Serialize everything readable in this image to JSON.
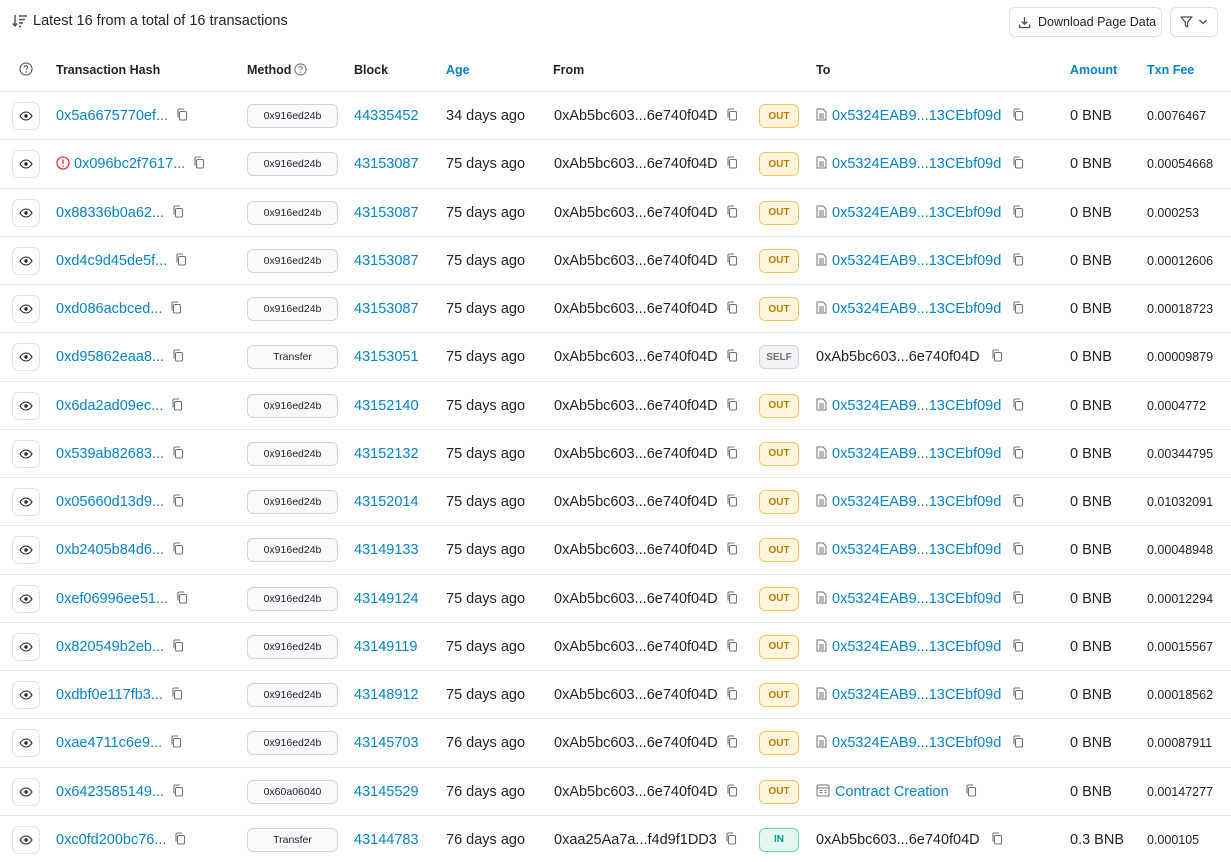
{
  "header": {
    "summary": "Latest 16 from a total of 16 transactions",
    "download_label": "Download Page Data"
  },
  "columns": {
    "hash": "Transaction Hash",
    "method": "Method",
    "block": "Block",
    "age": "Age",
    "from": "From",
    "to": "To",
    "amount": "Amount",
    "fee": "Txn Fee"
  },
  "rows": [
    {
      "hash": "0x5a6675770ef...",
      "error": false,
      "method": "0x916ed24b",
      "block": "44335452",
      "age": "34 days ago",
      "from": "0xAb5bc603...6e740f04D",
      "from_link": false,
      "dir": "OUT",
      "to": "0x5324EAB9...13CEbf09d",
      "to_type": "contract",
      "amount": "0 BNB",
      "fee": "0.0076467"
    },
    {
      "hash": "0x096bc2f7617...",
      "error": true,
      "method": "0x916ed24b",
      "block": "43153087",
      "age": "75 days ago",
      "from": "0xAb5bc603...6e740f04D",
      "from_link": false,
      "dir": "OUT",
      "to": "0x5324EAB9...13CEbf09d",
      "to_type": "contract",
      "amount": "0 BNB",
      "fee": "0.00054668"
    },
    {
      "hash": "0x88336b0a62...",
      "error": false,
      "method": "0x916ed24b",
      "block": "43153087",
      "age": "75 days ago",
      "from": "0xAb5bc603...6e740f04D",
      "from_link": false,
      "dir": "OUT",
      "to": "0x5324EAB9...13CEbf09d",
      "to_type": "contract",
      "amount": "0 BNB",
      "fee": "0.000253"
    },
    {
      "hash": "0xd4c9d45de5f...",
      "error": false,
      "method": "0x916ed24b",
      "block": "43153087",
      "age": "75 days ago",
      "from": "0xAb5bc603...6e740f04D",
      "from_link": false,
      "dir": "OUT",
      "to": "0x5324EAB9...13CEbf09d",
      "to_type": "contract",
      "amount": "0 BNB",
      "fee": "0.00012606"
    },
    {
      "hash": "0xd086acbced...",
      "error": false,
      "method": "0x916ed24b",
      "block": "43153087",
      "age": "75 days ago",
      "from": "0xAb5bc603...6e740f04D",
      "from_link": false,
      "dir": "OUT",
      "to": "0x5324EAB9...13CEbf09d",
      "to_type": "contract",
      "amount": "0 BNB",
      "fee": "0.00018723"
    },
    {
      "hash": "0xd95862eaa8...",
      "error": false,
      "method": "Transfer",
      "block": "43153051",
      "age": "75 days ago",
      "from": "0xAb5bc603...6e740f04D",
      "from_link": false,
      "dir": "SELF",
      "to": "0xAb5bc603...6e740f04D",
      "to_type": "plain",
      "amount": "0 BNB",
      "fee": "0.00009879"
    },
    {
      "hash": "0x6da2ad09ec...",
      "error": false,
      "method": "0x916ed24b",
      "block": "43152140",
      "age": "75 days ago",
      "from": "0xAb5bc603...6e740f04D",
      "from_link": false,
      "dir": "OUT",
      "to": "0x5324EAB9...13CEbf09d",
      "to_type": "contract",
      "amount": "0 BNB",
      "fee": "0.0004772"
    },
    {
      "hash": "0x539ab82683...",
      "error": false,
      "method": "0x916ed24b",
      "block": "43152132",
      "age": "75 days ago",
      "from": "0xAb5bc603...6e740f04D",
      "from_link": false,
      "dir": "OUT",
      "to": "0x5324EAB9...13CEbf09d",
      "to_type": "contract",
      "amount": "0 BNB",
      "fee": "0.00344795"
    },
    {
      "hash": "0x05660d13d9...",
      "error": false,
      "method": "0x916ed24b",
      "block": "43152014",
      "age": "75 days ago",
      "from": "0xAb5bc603...6e740f04D",
      "from_link": false,
      "dir": "OUT",
      "to": "0x5324EAB9...13CEbf09d",
      "to_type": "contract",
      "amount": "0 BNB",
      "fee": "0.01032091"
    },
    {
      "hash": "0xb2405b84d6...",
      "error": false,
      "method": "0x916ed24b",
      "block": "43149133",
      "age": "75 days ago",
      "from": "0xAb5bc603...6e740f04D",
      "from_link": false,
      "dir": "OUT",
      "to": "0x5324EAB9...13CEbf09d",
      "to_type": "contract",
      "amount": "0 BNB",
      "fee": "0.00048948"
    },
    {
      "hash": "0xef06996ee51...",
      "error": false,
      "method": "0x916ed24b",
      "block": "43149124",
      "age": "75 days ago",
      "from": "0xAb5bc603...6e740f04D",
      "from_link": false,
      "dir": "OUT",
      "to": "0x5324EAB9...13CEbf09d",
      "to_type": "contract",
      "amount": "0 BNB",
      "fee": "0.00012294"
    },
    {
      "hash": "0x820549b2eb...",
      "error": false,
      "method": "0x916ed24b",
      "block": "43149119",
      "age": "75 days ago",
      "from": "0xAb5bc603...6e740f04D",
      "from_link": false,
      "dir": "OUT",
      "to": "0x5324EAB9...13CEbf09d",
      "to_type": "contract",
      "amount": "0 BNB",
      "fee": "0.00015567"
    },
    {
      "hash": "0xdbf0e117fb3...",
      "error": false,
      "method": "0x916ed24b",
      "block": "43148912",
      "age": "75 days ago",
      "from": "0xAb5bc603...6e740f04D",
      "from_link": false,
      "dir": "OUT",
      "to": "0x5324EAB9...13CEbf09d",
      "to_type": "contract",
      "amount": "0 BNB",
      "fee": "0.00018562"
    },
    {
      "hash": "0xae4711c6e9...",
      "error": false,
      "method": "0x916ed24b",
      "block": "43145703",
      "age": "76 days ago",
      "from": "0xAb5bc603...6e740f04D",
      "from_link": false,
      "dir": "OUT",
      "to": "0x5324EAB9...13CEbf09d",
      "to_type": "contract",
      "amount": "0 BNB",
      "fee": "0.00087911"
    },
    {
      "hash": "0x6423585149...",
      "error": false,
      "method": "0x60a06040",
      "block": "43145529",
      "age": "76 days ago",
      "from": "0xAb5bc603...6e740f04D",
      "from_link": false,
      "dir": "OUT",
      "to": "Contract Creation",
      "to_type": "creation",
      "amount": "0 BNB",
      "fee": "0.00147277"
    },
    {
      "hash": "0xc0fd200bc76...",
      "error": false,
      "method": "Transfer",
      "block": "43144783",
      "age": "76 days ago",
      "from": "0xaa25Aa7a...f4d9f1DD3",
      "from_link": true,
      "dir": "IN",
      "to": "0xAb5bc603...6e740f04D",
      "to_type": "plain",
      "amount": "0.3 BNB",
      "fee": "0.000105"
    }
  ]
}
